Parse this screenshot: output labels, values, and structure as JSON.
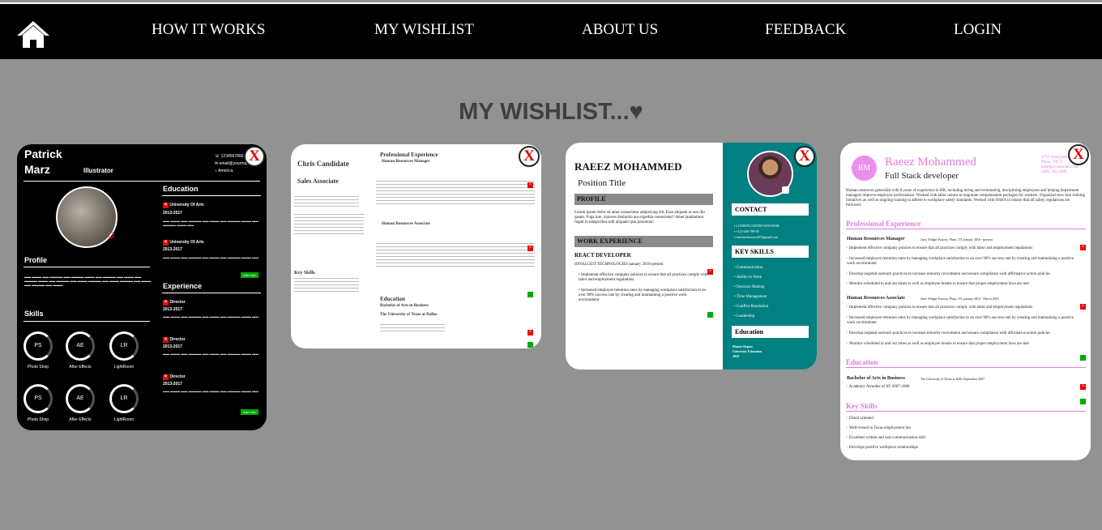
{
  "nav": {
    "home_icon": "home-icon",
    "links": [
      "HOW IT WORKS",
      "MY WISHLIST",
      "ABOUT US",
      "FEEDBACK",
      "LOGIN"
    ]
  },
  "page": {
    "title": "MY WISHLIST...♥"
  },
  "remove_label": "X",
  "cards": [
    {
      "name_first": "Patrick",
      "name_last": "Marz",
      "role": "Illustrator",
      "phone": "1234567890",
      "email": "email@yourmail",
      "location": "America",
      "profile_heading": "Profile",
      "education_heading": "Education",
      "edu": [
        {
          "title": "University Of Arts",
          "years": "2013-2017"
        },
        {
          "title": "University Of Arts",
          "years": "2013-2017"
        }
      ],
      "experience_heading": "Experience",
      "exp": [
        {
          "title": "Director",
          "years": "2013-2017"
        },
        {
          "title": "Director",
          "years": "2013-2017"
        },
        {
          "title": "Director",
          "years": "2013-2017"
        }
      ],
      "add_label": "Add new",
      "skills_heading": "Skills",
      "skills": [
        {
          "abbr": "PS",
          "label": "Photo Shop"
        },
        {
          "abbr": "AE",
          "label": "After Effects"
        },
        {
          "abbr": "LR",
          "label": "LightRoom"
        },
        {
          "abbr": "PS",
          "label": "Photo Shop"
        },
        {
          "abbr": "AE",
          "label": "After Effects"
        },
        {
          "abbr": "LR",
          "label": "LightRoom"
        }
      ]
    },
    {
      "name": "Chris Candidate",
      "role": "Sales Associate",
      "exp_heading": "Professional Experience",
      "job1": "Human Resources Manager",
      "job2": "Human Resources Associate",
      "skills_heading": "Key Skills",
      "edu_heading": "Education",
      "degree": "Bachelor of Arts in Business",
      "school": "The University of Texas at Dallas"
    },
    {
      "name": "RAEEZ MOHAMMED",
      "position": "Position Title",
      "profile_heading": "PROFILE",
      "profile_text": "Lorem ipsum dolor sit amet consectetur adipisicing elit. Esse aliquam at non illo ipsam. Fuga iure, maiores distinctio aut expedita consectetur? Amet laudantium fugiat in temporibus odit aliquam ipsa possimus!",
      "work_heading": "WORK EXPERIENCE",
      "job_title": "REACT DEVELOPER",
      "company": "IONALGEIT TECHNOLOGIES january 2016-present",
      "bullets": [
        "Implement effective company policies to ensure that all practices comply with labor and employment regulations",
        "Increased employee retention rates by managing workplace satisfaction to an over 90% success rate by creating and maintaining a positive work environment"
      ],
      "contact_heading": "CONTACT",
      "contact": [
        "LONDON,UNITED KINGDOM",
        "+123-456-789-00",
        "raeezmohammed97@gmail.com"
      ],
      "skills_heading": "KEY SKILLS",
      "skills": [
        "Communication",
        "Ability to Work",
        "Decision Making",
        "Time Management",
        "Conflict Resolution",
        "Leadership"
      ],
      "edu_heading": "Education",
      "edu": [
        "Master Degree",
        "University Education",
        "2018"
      ]
    },
    {
      "initials": "RM",
      "name": "Raeez Mohammed",
      "role": "Full Stack developer",
      "contact": [
        "4759 Sunnydale",
        "Plano, TX 75",
        "email@youremail.com",
        "(469) 385-2948"
      ],
      "summary": "Human resources generalist with 8 years of experience in HR, including hiring and terminating, disciplining employees and helping department managers improve employee performance. Worked with labor unions to negotiate compensation packages for workers. Organized new hire training initiatives as well as ongoing training to adhere to workplace safety standards. Worked with OSHA to ensure that all safety regulations are followed.",
      "exp_heading": "Professional Experience",
      "job1": "Human Resources Manager",
      "job1_meta": "Jim's Widget Factory, Plano, TX  january 2016 - present",
      "job2": "Human Resources Associate",
      "job2_meta": "Jim's Widget Factory, Plano, TX  january 2014 - March 2016",
      "job_bullets": [
        "Implement effective company policies to ensure that all practices comply with labor and employment regulations",
        "Increased employee retention rates by managing workplace satisfaction to an over 90% success rate by creating and maintaining a positive work environment",
        "Develop targeted outreach practices to increase minority recruitment and ensure compliance with affirmative action policies",
        "Monitor scheduled in and out times as well as employee breaks to ensure that proper employment laws are met"
      ],
      "edu_heading": "Education",
      "degree": "Bachelor of Arts in Business",
      "degree_meta": "The University of Texas at Dalls  September 2007",
      "edu_bullet": "Academic Awardee of AY 2007-2008",
      "skills_heading": "Key Skills",
      "skills": [
        "Detail oriented",
        "Well-versed in Texas employment law",
        "Excellent written and oral communication skill",
        "Develops positive workplace relationships"
      ]
    }
  ]
}
